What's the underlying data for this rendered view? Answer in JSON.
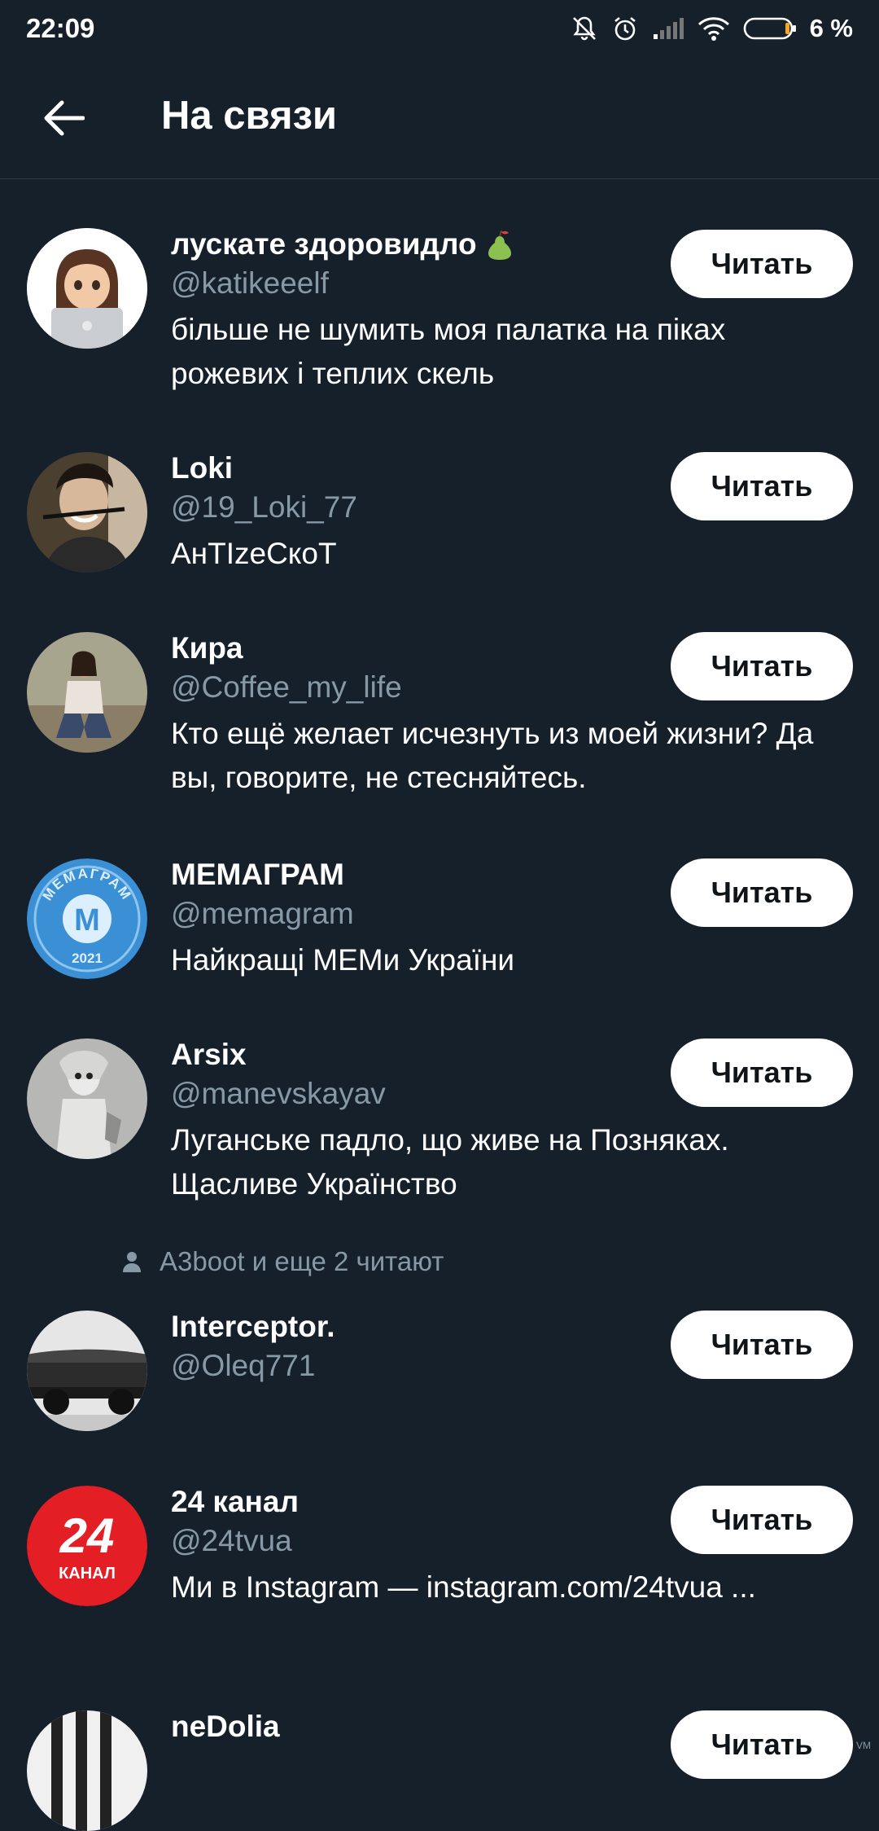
{
  "status_bar": {
    "time": "22:09",
    "battery": "6 %"
  },
  "header": {
    "title": "На связи"
  },
  "follow_label": "Читать",
  "social_context": "A3boot и еще 2 читают",
  "users": [
    {
      "name": "лускате здоровидло",
      "handle": "@katikeeelf",
      "bio": "більше не шумить моя палатка на піках рожевих і теплих скель"
    },
    {
      "name": "Loki",
      "handle": "@19_Loki_77",
      "bio": "АнТIzeCкоТ"
    },
    {
      "name": "Кира",
      "handle": "@Coffee_my_life",
      "bio": "Кто ещё желает исчезнуть из моей жизни? Да вы, говорите, не стесняйтесь."
    },
    {
      "name": "МЕМАГРАМ",
      "handle": "@memagram",
      "bio": "Найкращі МЕМи України"
    },
    {
      "name": "Arsix",
      "handle": "@manevskayav",
      "bio": "Луганське падло, що живе на Позняках. Щасливе Українство"
    },
    {
      "name": "Interceptor.",
      "handle": "@Oleq771",
      "bio": ""
    },
    {
      "name": "24 канал",
      "handle": "@24tvua",
      "bio": "Ми в Instagram — instagram.com/24tvua ..."
    },
    {
      "name": "neDolia",
      "handle": "",
      "bio": ""
    }
  ],
  "avatars": {
    "memagram_text": "МЕМАГРАМ",
    "memagram_letter": "M",
    "memagram_year": "2021",
    "tv24_number": "24",
    "tv24_label": "КАНАЛ"
  },
  "watermark": "VM",
  "colors": {
    "background": "#15202b",
    "secondary_text": "#8899a6",
    "button_bg": "#ffffff"
  }
}
